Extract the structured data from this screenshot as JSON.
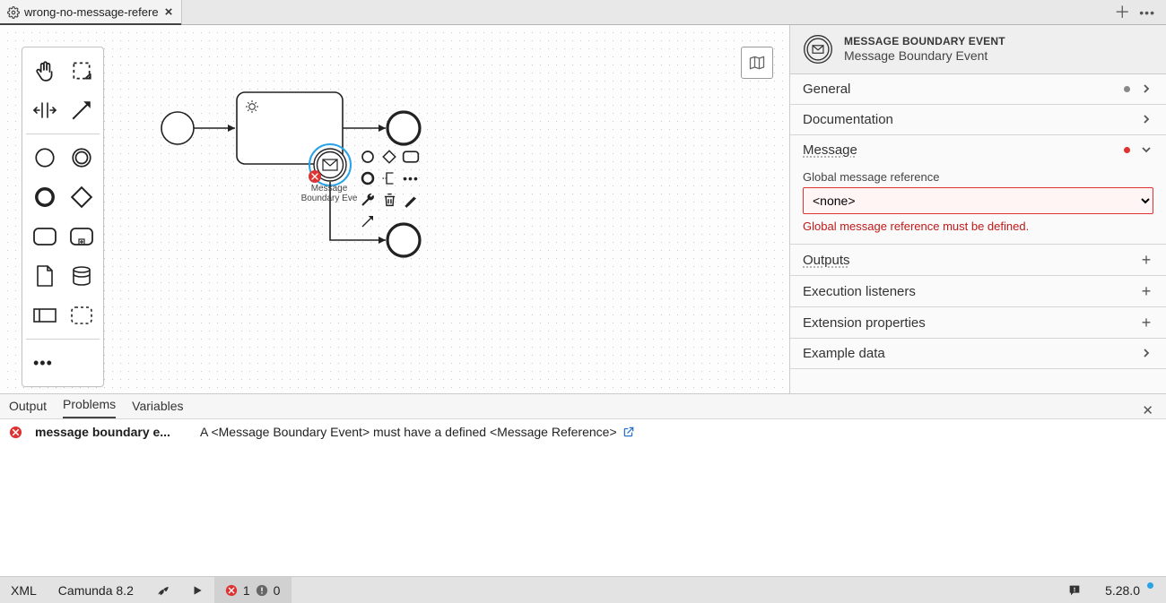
{
  "tabs": {
    "active_title": "wrong-no-message-refere"
  },
  "canvas": {
    "element_label_line1": "Message",
    "element_label_line2": "Boundary Eve"
  },
  "properties": {
    "header": {
      "eyebrow": "MESSAGE BOUNDARY EVENT",
      "title": "Message Boundary Event"
    },
    "sections": {
      "general": "General",
      "documentation": "Documentation",
      "message": "Message",
      "outputs": "Outputs",
      "exec_listeners": "Execution listeners",
      "ext_props": "Extension properties",
      "example_data": "Example data"
    },
    "message_group": {
      "field_label": "Global message reference",
      "value": "<none>",
      "error": "Global message reference must be defined."
    }
  },
  "bottom": {
    "tabs": {
      "output": "Output",
      "problems": "Problems",
      "variables": "Variables"
    },
    "problem": {
      "source": "message boundary e...",
      "message": "A <Message Boundary Event> must have a defined <Message Reference>"
    }
  },
  "status": {
    "xml": "XML",
    "platform": "Camunda 8.2",
    "errors": "1",
    "warnings": "0",
    "version": "5.28.0"
  }
}
